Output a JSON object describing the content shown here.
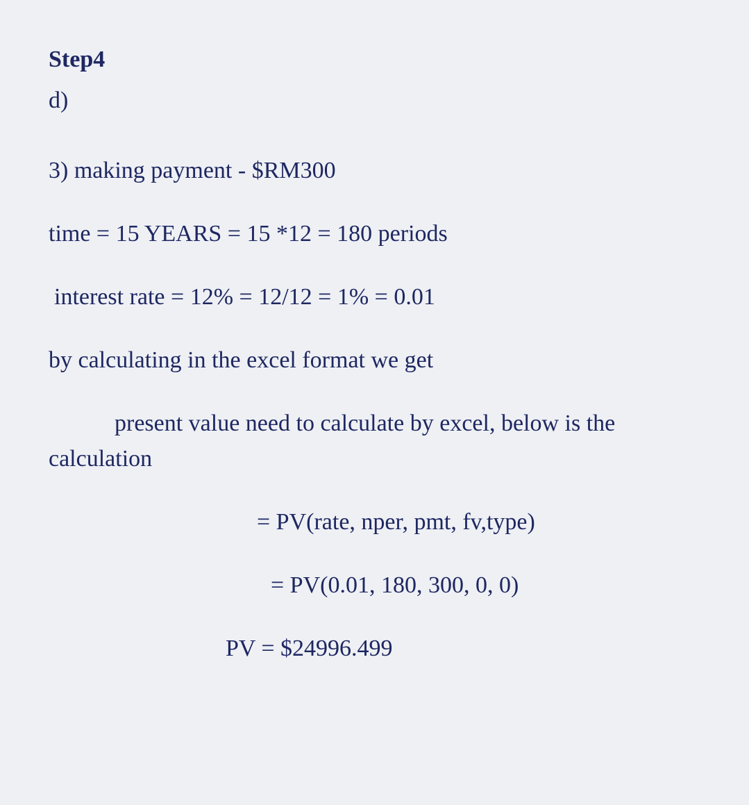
{
  "step": {
    "heading": "Step4",
    "sub": "d)"
  },
  "lines": {
    "l1": "3) making payment - $RM300",
    "l2": "time = 15 YEARS = 15 *12 = 180 periods",
    "l3": " interest rate = 12% = 12/12 = 1% = 0.01",
    "l4": "by calculating in the excel format we get",
    "l5_lead": "        ",
    "l5a": "present value need to calculate by excel, below is the calculation",
    "f1": "= PV(rate, nper, pmt, fv,type)",
    "f2": "= PV(0.01, 180, 300, 0, 0)",
    "f3": "PV = $24996.499"
  }
}
